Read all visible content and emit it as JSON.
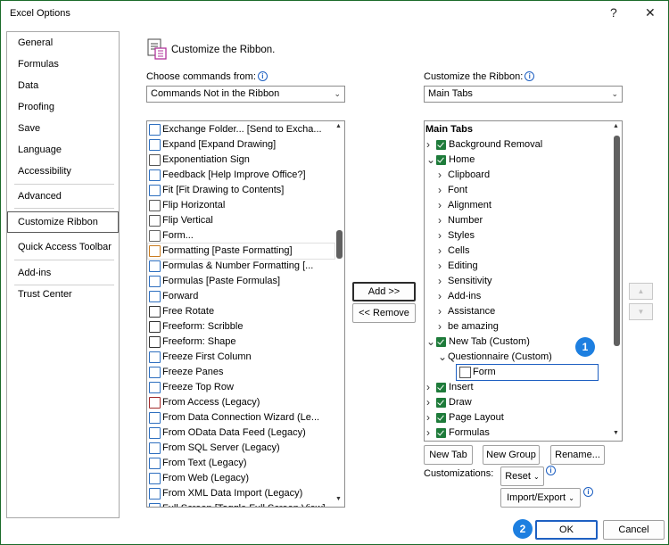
{
  "window": {
    "title": "Excel Options",
    "help": "?",
    "close": "✕"
  },
  "nav": {
    "items": [
      "General",
      "Formulas",
      "Data",
      "Proofing",
      "Save",
      "Language",
      "Accessibility",
      "Advanced",
      "Customize Ribbon",
      "Quick Access Toolbar",
      "Add-ins",
      "Trust Center"
    ],
    "selected": "Customize Ribbon"
  },
  "header": {
    "text": "Customize the Ribbon."
  },
  "left_panel": {
    "label": "Choose commands from:",
    "combo_value": "Commands Not in the Ribbon",
    "commands": [
      "Exchange Folder... [Send to Excha...",
      "Expand [Expand Drawing]",
      "Exponentiation Sign",
      "Feedback [Help Improve Office?]",
      "Fit [Fit Drawing to Contents]",
      "Flip Horizontal",
      "Flip Vertical",
      "Form...",
      "Formatting [Paste Formatting]",
      "Formulas & Number Formatting [...",
      "Formulas [Paste Formulas]",
      "Forward",
      "Free Rotate",
      "Freeform: Scribble",
      "Freeform: Shape",
      "Freeze First Column",
      "Freeze Panes",
      "Freeze Top Row",
      "From Access (Legacy)",
      "From Data Connection Wizard (Le...",
      "From OData Data Feed (Legacy)",
      "From SQL Server (Legacy)",
      "From Text (Legacy)",
      "From Web (Legacy)",
      "From XML Data Import (Legacy)",
      "Full Screen [Toggle Full Screen View]"
    ]
  },
  "middle": {
    "add": "Add >>",
    "remove": "<< Remove"
  },
  "right_panel": {
    "label": "Customize the Ribbon:",
    "combo_value": "Main Tabs",
    "tree_header": "Main Tabs",
    "tree": [
      {
        "label": "Background Removal",
        "level": 0,
        "expander": ">",
        "checked": true
      },
      {
        "label": "Home",
        "level": 0,
        "expander": "v",
        "checked": true
      },
      {
        "label": "Clipboard",
        "level": 1,
        "expander": ">"
      },
      {
        "label": "Font",
        "level": 1,
        "expander": ">"
      },
      {
        "label": "Alignment",
        "level": 1,
        "expander": ">"
      },
      {
        "label": "Number",
        "level": 1,
        "expander": ">"
      },
      {
        "label": "Styles",
        "level": 1,
        "expander": ">"
      },
      {
        "label": "Cells",
        "level": 1,
        "expander": ">"
      },
      {
        "label": "Editing",
        "level": 1,
        "expander": ">"
      },
      {
        "label": "Sensitivity",
        "level": 1,
        "expander": ">"
      },
      {
        "label": "Add-ins",
        "level": 1,
        "expander": ">"
      },
      {
        "label": "Assistance",
        "level": 1,
        "expander": ">"
      },
      {
        "label": "be amazing",
        "level": 1,
        "expander": ">"
      },
      {
        "label": "New Tab (Custom)",
        "level": 0,
        "expander": "v",
        "checked": true
      },
      {
        "label": "Questionnaire (Custom)",
        "level": 1,
        "expander": "v"
      },
      {
        "label": "Form",
        "level": 2,
        "expander": ""
      },
      {
        "label": "Insert",
        "level": 0,
        "expander": ">",
        "checked": true
      },
      {
        "label": "Draw",
        "level": 0,
        "expander": ">",
        "checked": true
      },
      {
        "label": "Page Layout",
        "level": 0,
        "expander": ">",
        "checked": true
      },
      {
        "label": "Formulas",
        "level": 0,
        "expander": ">",
        "checked": true
      }
    ],
    "new_tab": "New Tab",
    "new_group": "New Group",
    "rename": "Rename...",
    "customizations_label": "Customizations:",
    "reset": "Reset",
    "import_export": "Import/Export"
  },
  "badges": {
    "one": "1",
    "two": "2"
  },
  "footer": {
    "ok": "OK",
    "cancel": "Cancel"
  },
  "colors": {
    "check": "#1e7b3a",
    "badge": "#1d7fe0",
    "focus": "#1d5fc1"
  }
}
